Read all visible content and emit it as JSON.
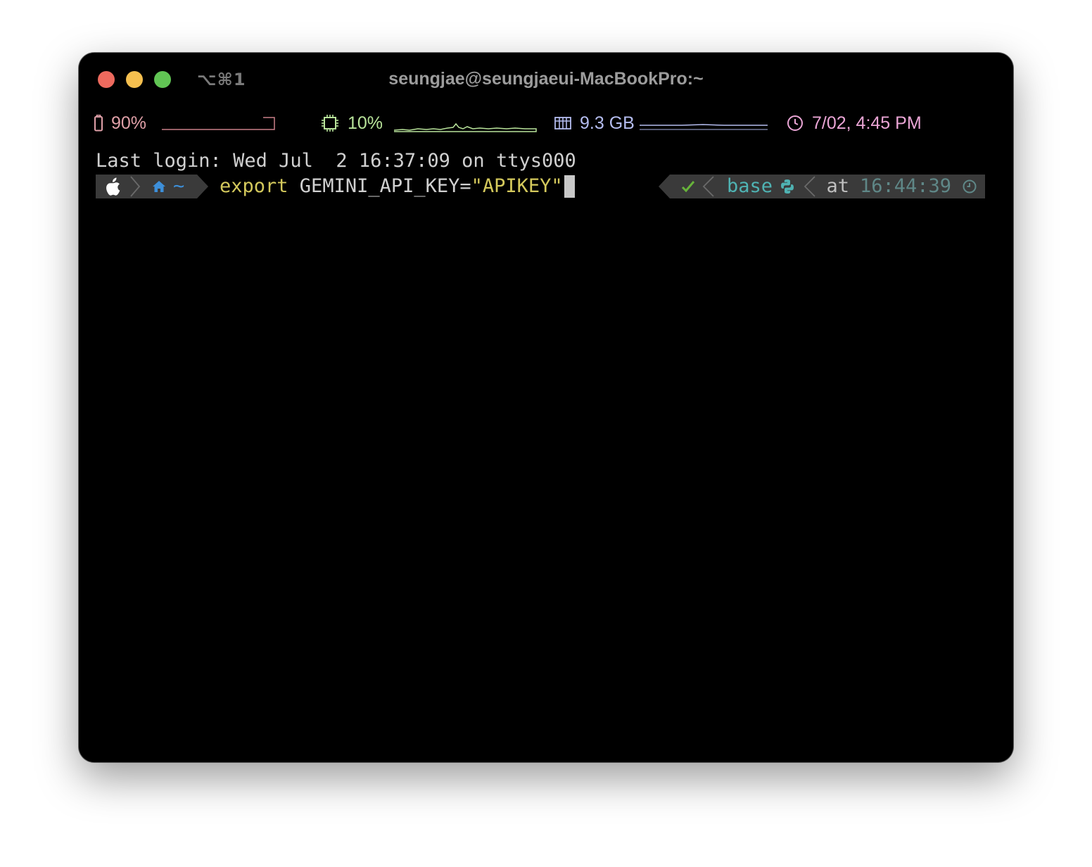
{
  "window": {
    "shortcut": "⌥⌘1",
    "title": "seungjae@seungjaeui-MacBookPro:~"
  },
  "status_bar": {
    "battery": {
      "icon": "battery-icon",
      "value": "90%",
      "color": "#e0a0a8"
    },
    "cpu": {
      "icon": "cpu-chip-icon",
      "value": "10%",
      "color": "#b8e39a"
    },
    "memory": {
      "icon": "memory-icon",
      "value": "9.3 GB",
      "color": "#b5bdf0"
    },
    "clock": {
      "icon": "clock-icon",
      "value": "7/02, 4:45 PM",
      "color": "#eaa5d5"
    }
  },
  "terminal": {
    "last_login": "Last login: Wed Jul  2 16:37:09 on ttys000",
    "prompt_left": {
      "os_icon": "apple-icon",
      "home_icon": "home-icon",
      "dir": "~"
    },
    "command": {
      "keyword": "export",
      "rest": " GEMINI_API_KEY=",
      "string": "\"APIKEY\""
    },
    "prompt_right": {
      "status_icon": "checkmark-icon",
      "env": "base",
      "env_icon": "python-icon",
      "at": "at",
      "time": "16:44:39",
      "time_icon": "clock-icon"
    }
  },
  "colors": {
    "terminal_bg": "#000000",
    "segment_bg": "#3a3a3a",
    "accent_blue": "#3d8fd9",
    "accent_cyan": "#4fb3b3",
    "accent_green": "#67b33a",
    "time_color": "#5f8787"
  }
}
